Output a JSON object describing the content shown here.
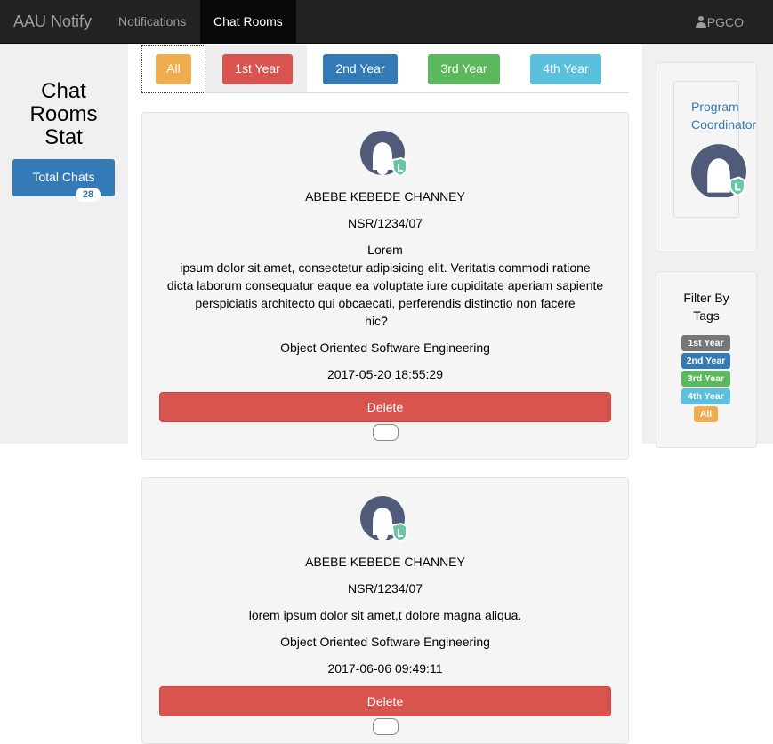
{
  "navbar": {
    "brand": "AAU Notify",
    "items": [
      {
        "label": "Notifications",
        "active": false
      },
      {
        "label": "Chat Rooms",
        "active": true
      }
    ],
    "user": "PGCO",
    "icon": "user-icon"
  },
  "left_sidebar": {
    "title_lines": [
      "Chat",
      "Rooms",
      "Stat"
    ],
    "total_chats_label": "Total Chats",
    "total_chats_count": "28"
  },
  "tabs": [
    {
      "label": "All",
      "color": "#f0ad4e"
    },
    {
      "label": "1st Year",
      "color": "#d9534f"
    },
    {
      "label": "2nd Year",
      "color": "#337ab7"
    },
    {
      "label": "3rd Year",
      "color": "#5cb85c"
    },
    {
      "label": "4th Year",
      "color": "#5bc0de"
    }
  ],
  "chats": [
    {
      "name": "ABEBE KEBEDE CHANNEY",
      "id": "NSR/1234/07",
      "message_lines": [
        "Lorem",
        "ipsum dolor sit amet, consectetur adipisicing elit. Veritatis commodi ratione",
        "dicta laborum consequatur eaque ea voluptate iure cupiditate aperiam sapiente",
        "perspiciatis architecto qui obcaecati, perferendis distinctio non facere",
        "hic?"
      ],
      "course": "Object Oriented Software Engineering",
      "timestamp": "2017-05-20 18:55:29",
      "delete_label": "Delete"
    },
    {
      "name": "ABEBE KEBEDE CHANNEY",
      "id": "NSR/1234/07",
      "message_lines": [
        "lorem ipsum dolor sit amet,t dolore magna aliqua."
      ],
      "course": "Object Oriented Software Engineering",
      "timestamp": "2017-06-06 09:49:11",
      "delete_label": "Delete"
    }
  ],
  "right_sidebar": {
    "coordinator_lines": [
      "Program",
      "Coordinator"
    ],
    "filter_title_lines": [
      "Filter By",
      "Tags"
    ],
    "tags": [
      {
        "label": "1st Year",
        "color": "#777777"
      },
      {
        "label": "2nd Year",
        "color": "#337ab7"
      },
      {
        "label": "3rd Year",
        "color": "#5cb85c"
      },
      {
        "label": "4th Year",
        "color": "#5bc0de"
      },
      {
        "label": "All",
        "color": "#f0ad4e"
      }
    ]
  },
  "colors": {
    "navbar_bg": "#222222",
    "primary": "#337ab7",
    "danger": "#d9534f",
    "avatar": "#4f5b78",
    "avatar_badge": "#68c6a5"
  }
}
